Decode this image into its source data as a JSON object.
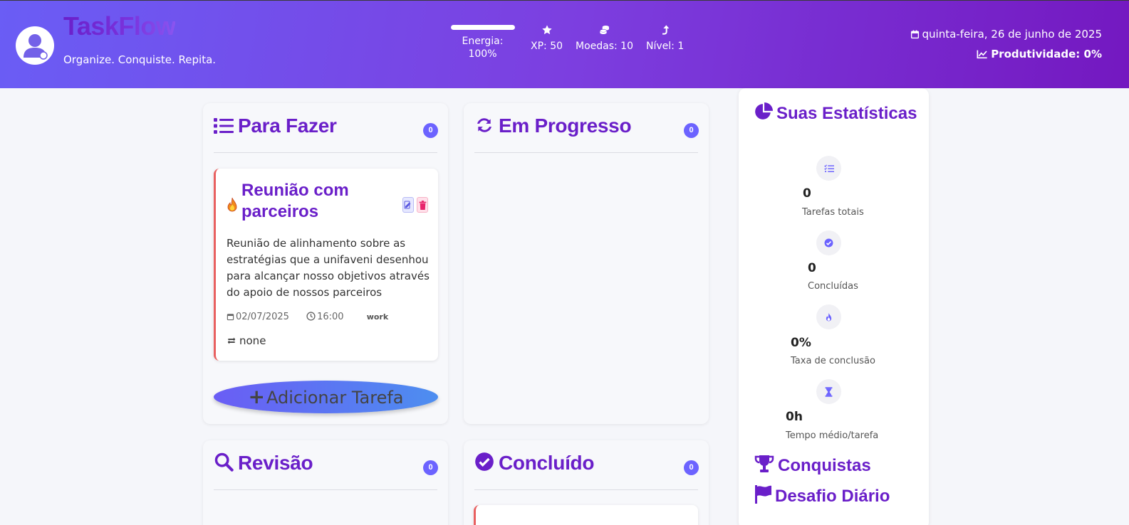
{
  "header": {
    "brand": "TaskFlow",
    "tagline": "Organize. Conquiste. Repita.",
    "energy_label": "Energia: 100%",
    "energy_fraction": 1.0,
    "xp_label": "XP: 50",
    "coins_label": "Moedas: 10",
    "level_label": "Nível: 1",
    "date": "quinta-feira, 26 de junho de 2025",
    "productivity": "Produtividade: 0%"
  },
  "columns": {
    "todo": {
      "title": "Para Fazer",
      "count": "0"
    },
    "progress": {
      "title": "Em Progresso",
      "count": "0"
    },
    "review": {
      "title": "Revisão",
      "count": "0"
    },
    "done": {
      "title": "Concluído",
      "count": "0"
    }
  },
  "task": {
    "title": "Reunião com parceiros",
    "description": "Reunião de alinhamento sobre as estratégias que a unifaveni desenhou para alcançar nosso objetivos através do apoio de nossos parceiros",
    "date": "02/07/2025",
    "time": "16:00",
    "tag": "work",
    "recurrence": "none",
    "priority_icon": "fire-icon"
  },
  "add_task_label": "Adicionar Tarefa",
  "sidebar": {
    "stats_title": "Suas Estatísticas",
    "stats": [
      {
        "value": "0",
        "label": "Tarefas totais",
        "icon": "list-check-icon"
      },
      {
        "value": "0",
        "label": "Concluídas",
        "icon": "check-circle-icon"
      },
      {
        "value": "0%",
        "label": "Taxa de conclusão",
        "icon": "fire-icon"
      },
      {
        "value": "0h",
        "label": "Tempo médio/tarefa",
        "icon": "hourglass-icon"
      }
    ],
    "achievements_title": "Conquistas",
    "challenge_title": "Desafio Diário"
  },
  "colors": {
    "primary": "#6a1fc9",
    "accent": "#6c63ff",
    "priority_high": "#e86060"
  }
}
